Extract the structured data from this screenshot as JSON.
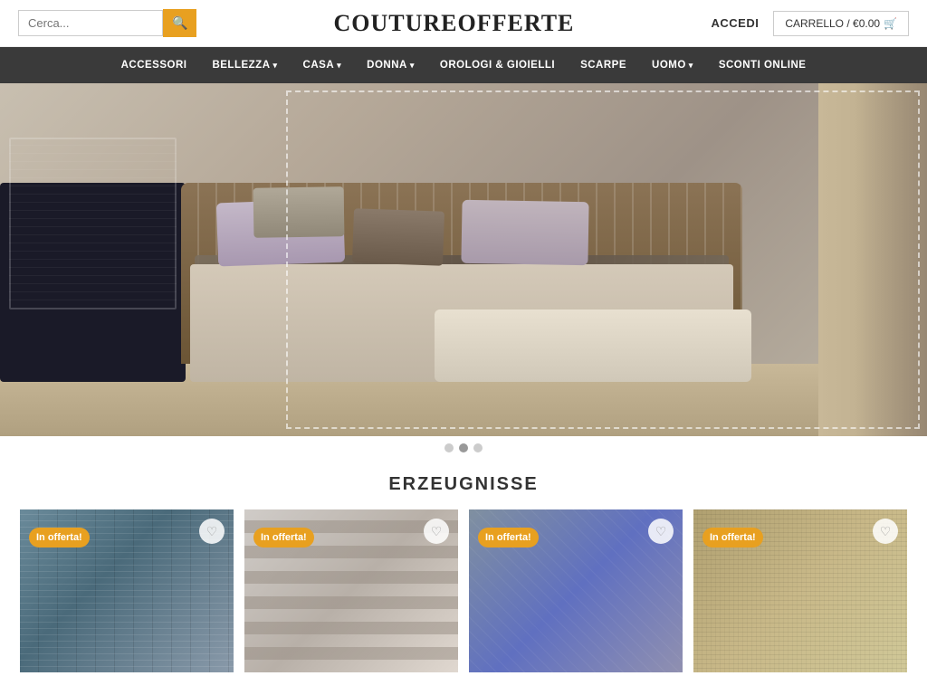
{
  "header": {
    "search_placeholder": "Cerca...",
    "search_icon": "🔍",
    "logo": "COUTUREOFFERTE",
    "accedi_label": "ACCEDI",
    "cart_label": "CARRELLO / €0.00",
    "cart_icon": "🛒"
  },
  "nav": {
    "items": [
      {
        "label": "ACCESSORI",
        "has_dropdown": false
      },
      {
        "label": "BELLEZZA",
        "has_dropdown": true
      },
      {
        "label": "CASA",
        "has_dropdown": true
      },
      {
        "label": "DONNA",
        "has_dropdown": true
      },
      {
        "label": "OROLOGI & GIOIELLI",
        "has_dropdown": false
      },
      {
        "label": "SCARPE",
        "has_dropdown": false
      },
      {
        "label": "UOMO",
        "has_dropdown": true
      },
      {
        "label": "SCONTI ONLINE",
        "has_dropdown": false
      }
    ]
  },
  "carousel": {
    "dots": [
      {
        "active": false
      },
      {
        "active": true
      },
      {
        "active": false
      }
    ]
  },
  "products": {
    "section_title": "Erzeugnisse",
    "items": [
      {
        "badge": "In offerta!",
        "bg_class": "prod1-bg",
        "wishlist_icon": "♡"
      },
      {
        "badge": "In offerta!",
        "bg_class": "prod2-bg",
        "wishlist_icon": "♡"
      },
      {
        "badge": "In offerta!",
        "bg_class": "prod3-bg",
        "wishlist_icon": "♡"
      },
      {
        "badge": "In offerta!",
        "bg_class": "prod4-bg",
        "wishlist_icon": "♡"
      }
    ]
  }
}
